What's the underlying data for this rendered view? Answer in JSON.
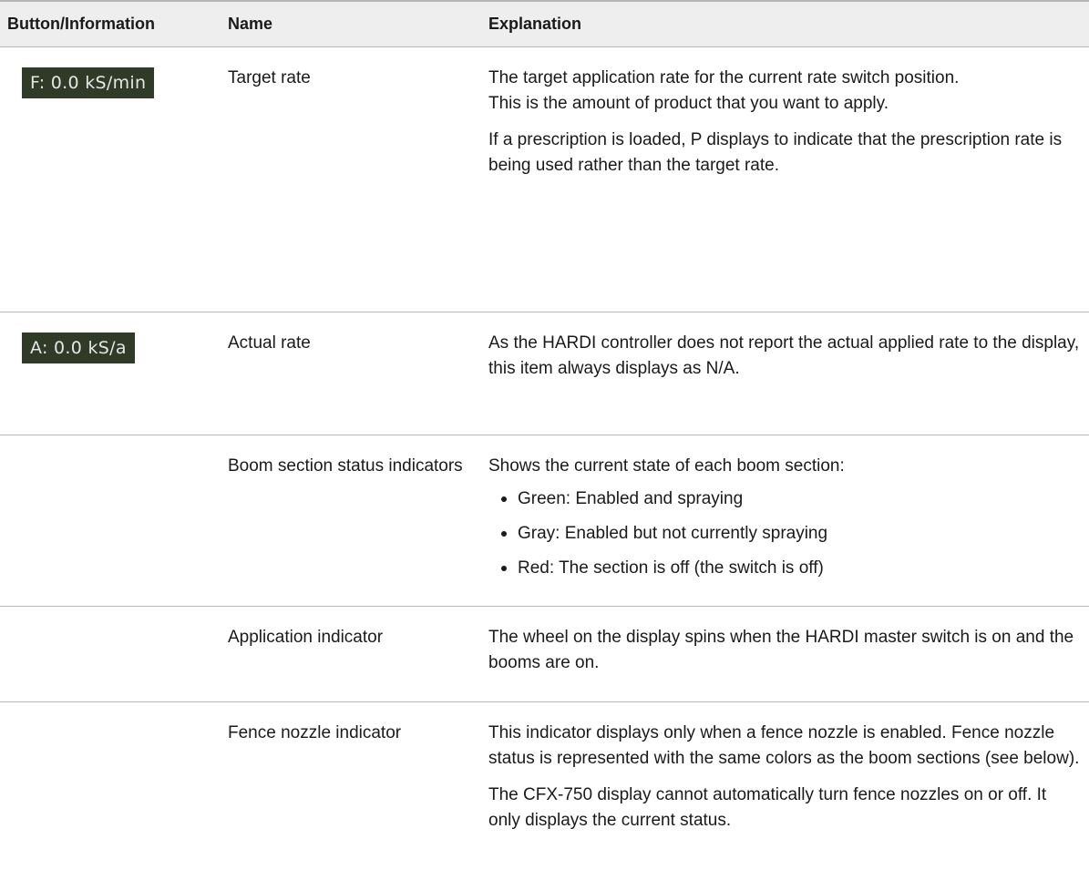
{
  "header": {
    "col1": "Button/Information",
    "col2": "Name",
    "col3": "Explanation"
  },
  "rows": [
    {
      "display": "F: 0.0 kS/min",
      "name": "Target rate",
      "paragraphs": [
        "The target application rate for the current rate switch position.",
        "This is the amount of product that you want to apply.",
        "If a prescription is loaded, P displays to indicate that the prescription rate is being used rather than the target rate."
      ]
    },
    {
      "display": "A: 0.0 kS/a",
      "name": "Actual rate",
      "paragraphs": [
        "As the HARDI controller does not report the actual applied rate to the display, this item always displays as N/A."
      ]
    },
    {
      "name": "Boom section status indicators",
      "intro": "Shows the current state of each boom section:",
      "bullets": [
        "Green: Enabled and spraying",
        "Gray: Enabled but not currently spraying",
        "Red: The section is off (the switch is off)"
      ]
    },
    {
      "name": "Application indicator",
      "paragraphs": [
        "The wheel on the display spins when the HARDI master switch is on and the booms are on."
      ]
    },
    {
      "name": "Fence nozzle indicator",
      "paragraphs": [
        "This indicator displays only when a fence nozzle is enabled. Fence nozzle status is represented with the same colors as the boom sections (see below).",
        "The CFX-750 display cannot automatically turn fence nozzles on or off. It only displays the current status."
      ]
    }
  ]
}
